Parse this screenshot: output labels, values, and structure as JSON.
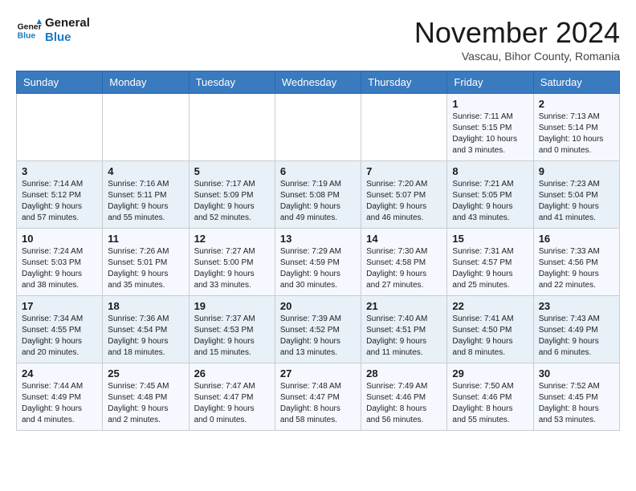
{
  "logo": {
    "text_general": "General",
    "text_blue": "Blue"
  },
  "header": {
    "title": "November 2024",
    "subtitle": "Vascau, Bihor County, Romania"
  },
  "weekdays": [
    "Sunday",
    "Monday",
    "Tuesday",
    "Wednesday",
    "Thursday",
    "Friday",
    "Saturday"
  ],
  "weeks": [
    [
      {
        "day": "",
        "info": ""
      },
      {
        "day": "",
        "info": ""
      },
      {
        "day": "",
        "info": ""
      },
      {
        "day": "",
        "info": ""
      },
      {
        "day": "",
        "info": ""
      },
      {
        "day": "1",
        "info": "Sunrise: 7:11 AM\nSunset: 5:15 PM\nDaylight: 10 hours\nand 3 minutes."
      },
      {
        "day": "2",
        "info": "Sunrise: 7:13 AM\nSunset: 5:14 PM\nDaylight: 10 hours\nand 0 minutes."
      }
    ],
    [
      {
        "day": "3",
        "info": "Sunrise: 7:14 AM\nSunset: 5:12 PM\nDaylight: 9 hours\nand 57 minutes."
      },
      {
        "day": "4",
        "info": "Sunrise: 7:16 AM\nSunset: 5:11 PM\nDaylight: 9 hours\nand 55 minutes."
      },
      {
        "day": "5",
        "info": "Sunrise: 7:17 AM\nSunset: 5:09 PM\nDaylight: 9 hours\nand 52 minutes."
      },
      {
        "day": "6",
        "info": "Sunrise: 7:19 AM\nSunset: 5:08 PM\nDaylight: 9 hours\nand 49 minutes."
      },
      {
        "day": "7",
        "info": "Sunrise: 7:20 AM\nSunset: 5:07 PM\nDaylight: 9 hours\nand 46 minutes."
      },
      {
        "day": "8",
        "info": "Sunrise: 7:21 AM\nSunset: 5:05 PM\nDaylight: 9 hours\nand 43 minutes."
      },
      {
        "day": "9",
        "info": "Sunrise: 7:23 AM\nSunset: 5:04 PM\nDaylight: 9 hours\nand 41 minutes."
      }
    ],
    [
      {
        "day": "10",
        "info": "Sunrise: 7:24 AM\nSunset: 5:03 PM\nDaylight: 9 hours\nand 38 minutes."
      },
      {
        "day": "11",
        "info": "Sunrise: 7:26 AM\nSunset: 5:01 PM\nDaylight: 9 hours\nand 35 minutes."
      },
      {
        "day": "12",
        "info": "Sunrise: 7:27 AM\nSunset: 5:00 PM\nDaylight: 9 hours\nand 33 minutes."
      },
      {
        "day": "13",
        "info": "Sunrise: 7:29 AM\nSunset: 4:59 PM\nDaylight: 9 hours\nand 30 minutes."
      },
      {
        "day": "14",
        "info": "Sunrise: 7:30 AM\nSunset: 4:58 PM\nDaylight: 9 hours\nand 27 minutes."
      },
      {
        "day": "15",
        "info": "Sunrise: 7:31 AM\nSunset: 4:57 PM\nDaylight: 9 hours\nand 25 minutes."
      },
      {
        "day": "16",
        "info": "Sunrise: 7:33 AM\nSunset: 4:56 PM\nDaylight: 9 hours\nand 22 minutes."
      }
    ],
    [
      {
        "day": "17",
        "info": "Sunrise: 7:34 AM\nSunset: 4:55 PM\nDaylight: 9 hours\nand 20 minutes."
      },
      {
        "day": "18",
        "info": "Sunrise: 7:36 AM\nSunset: 4:54 PM\nDaylight: 9 hours\nand 18 minutes."
      },
      {
        "day": "19",
        "info": "Sunrise: 7:37 AM\nSunset: 4:53 PM\nDaylight: 9 hours\nand 15 minutes."
      },
      {
        "day": "20",
        "info": "Sunrise: 7:39 AM\nSunset: 4:52 PM\nDaylight: 9 hours\nand 13 minutes."
      },
      {
        "day": "21",
        "info": "Sunrise: 7:40 AM\nSunset: 4:51 PM\nDaylight: 9 hours\nand 11 minutes."
      },
      {
        "day": "22",
        "info": "Sunrise: 7:41 AM\nSunset: 4:50 PM\nDaylight: 9 hours\nand 8 minutes."
      },
      {
        "day": "23",
        "info": "Sunrise: 7:43 AM\nSunset: 4:49 PM\nDaylight: 9 hours\nand 6 minutes."
      }
    ],
    [
      {
        "day": "24",
        "info": "Sunrise: 7:44 AM\nSunset: 4:49 PM\nDaylight: 9 hours\nand 4 minutes."
      },
      {
        "day": "25",
        "info": "Sunrise: 7:45 AM\nSunset: 4:48 PM\nDaylight: 9 hours\nand 2 minutes."
      },
      {
        "day": "26",
        "info": "Sunrise: 7:47 AM\nSunset: 4:47 PM\nDaylight: 9 hours\nand 0 minutes."
      },
      {
        "day": "27",
        "info": "Sunrise: 7:48 AM\nSunset: 4:47 PM\nDaylight: 8 hours\nand 58 minutes."
      },
      {
        "day": "28",
        "info": "Sunrise: 7:49 AM\nSunset: 4:46 PM\nDaylight: 8 hours\nand 56 minutes."
      },
      {
        "day": "29",
        "info": "Sunrise: 7:50 AM\nSunset: 4:46 PM\nDaylight: 8 hours\nand 55 minutes."
      },
      {
        "day": "30",
        "info": "Sunrise: 7:52 AM\nSunset: 4:45 PM\nDaylight: 8 hours\nand 53 minutes."
      }
    ]
  ]
}
